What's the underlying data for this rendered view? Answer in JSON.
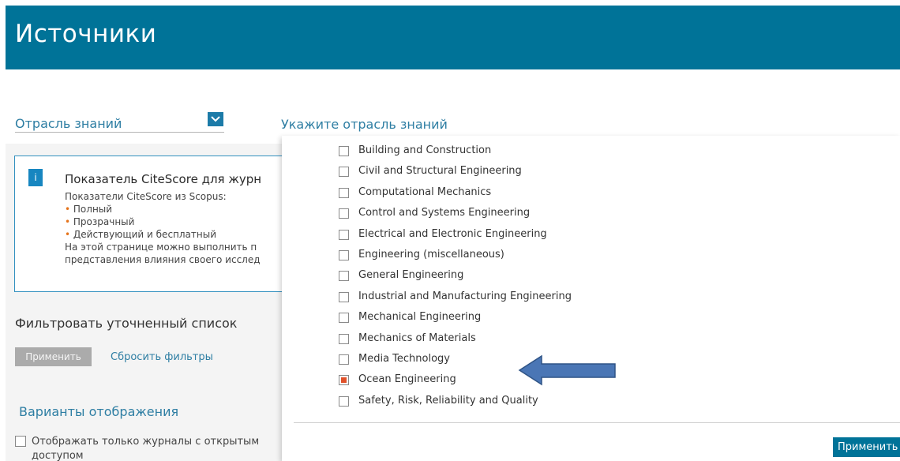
{
  "header": {
    "title": "Источники"
  },
  "subject_select": {
    "label": "Отрасль знаний",
    "dropdown_icon": "chevron-down-icon"
  },
  "info": {
    "icon": "info-icon",
    "icon_text": "i",
    "title": "Показатель CiteScore для журн",
    "subtitle": "Показатели CiteScore из Scopus:",
    "bullets": [
      "Полный",
      "Прозрачный",
      "Действующий и бесплатный"
    ],
    "body_lines": [
      "На этой странице можно выполнить п",
      "представления влияния своего исслед"
    ]
  },
  "filters": {
    "title": "Фильтровать уточненный список",
    "apply_label": "Применить",
    "reset_label": "Сбросить фильтры"
  },
  "display": {
    "title": "Варианты отображения",
    "open_access_label": "Отображать только журналы с открытым доступом"
  },
  "dropdown": {
    "title": "Укажите отрасль знаний",
    "options": [
      {
        "label": "Building and Construction",
        "checked": false
      },
      {
        "label": "Civil and Structural Engineering",
        "checked": false
      },
      {
        "label": "Computational Mechanics",
        "checked": false
      },
      {
        "label": "Control and Systems Engineering",
        "checked": false
      },
      {
        "label": "Electrical and Electronic Engineering",
        "checked": false
      },
      {
        "label": "Engineering (miscellaneous)",
        "checked": false
      },
      {
        "label": "General Engineering",
        "checked": false
      },
      {
        "label": "Industrial and Manufacturing Engineering",
        "checked": false
      },
      {
        "label": "Mechanical Engineering",
        "checked": false
      },
      {
        "label": "Mechanics of Materials",
        "checked": false
      },
      {
        "label": "Media Technology",
        "checked": false
      },
      {
        "label": "Ocean Engineering",
        "checked": true
      },
      {
        "label": "Safety, Risk, Reliability and Quality",
        "checked": false
      }
    ],
    "apply_label": "Применить"
  },
  "colors": {
    "brand": "#007398",
    "link": "#2e7ea3",
    "checkbox_checked": "#e0512a",
    "annotation_arrow": "#4a76b5"
  }
}
